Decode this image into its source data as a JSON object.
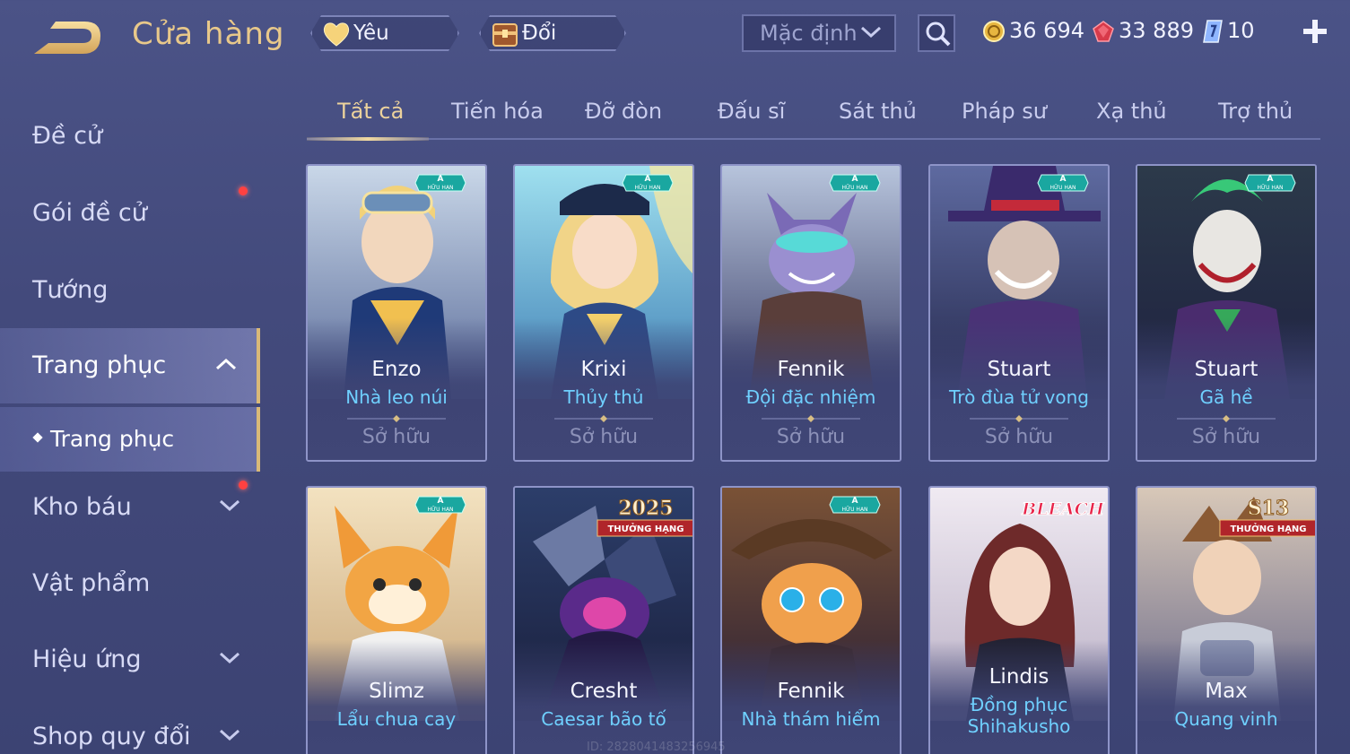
{
  "header": {
    "title": "Cửa hàng",
    "favorite_label": "Yêu thích",
    "swap_label": "Đổi mảnh",
    "sort_value": "Mặc định",
    "currencies": {
      "gold": "36 694",
      "ruby": "33 889",
      "voucher": "10"
    }
  },
  "sidebar": {
    "items": [
      {
        "label": "Đề cử"
      },
      {
        "label": "Gói đề cử"
      },
      {
        "label": "Tướng"
      },
      {
        "label": "Trang phục"
      },
      {
        "label": "Kho báu"
      },
      {
        "label": "Vật phẩm"
      },
      {
        "label": "Hiệu ứng"
      },
      {
        "label": "Shop quy đổi"
      }
    ],
    "sub_item": "Trang phục"
  },
  "tabs": [
    {
      "label": "Tất cả"
    },
    {
      "label": "Tiến hóa"
    },
    {
      "label": "Đỡ đòn"
    },
    {
      "label": "Đấu sĩ"
    },
    {
      "label": "Sát thủ"
    },
    {
      "label": "Pháp sư"
    },
    {
      "label": "Xạ thủ"
    },
    {
      "label": "Trợ thủ"
    }
  ],
  "badges": {
    "limited_letter": "A",
    "limited_text": "HỮU HẠN",
    "rank_text": "THƯỞNG HẠNG",
    "season_2025": "2025",
    "season_s13": "S13",
    "bleach": "BLEACH"
  },
  "cards": [
    {
      "hero": "Enzo",
      "skin": "Nhà leo núi",
      "status": "Sở hữu"
    },
    {
      "hero": "Krixi",
      "skin": "Thủy thủ",
      "status": "Sở hữu"
    },
    {
      "hero": "Fennik",
      "skin": "Đội đặc nhiệm",
      "status": "Sở hữu"
    },
    {
      "hero": "Stuart",
      "skin": "Trò đùa tử vong",
      "status": "Sở hữu"
    },
    {
      "hero": "Stuart",
      "skin": "Gã hề",
      "status": "Sở hữu"
    },
    {
      "hero": "Slimz",
      "skin": "Lẩu chua cay"
    },
    {
      "hero": "Cresht",
      "skin": "Caesar bão tố"
    },
    {
      "hero": "Fennik",
      "skin": "Nhà thám hiểm"
    },
    {
      "hero": "Lindis",
      "skin": "Đồng phục Shihakusho"
    },
    {
      "hero": "Max",
      "skin": "Quang vinh"
    }
  ],
  "watermark": "ID: 2828041483256945",
  "colors": {
    "accent_gold": "#e8c88a",
    "skin_name": "#6fd0ff",
    "background": "#454c80",
    "notification": "#ff4141"
  }
}
